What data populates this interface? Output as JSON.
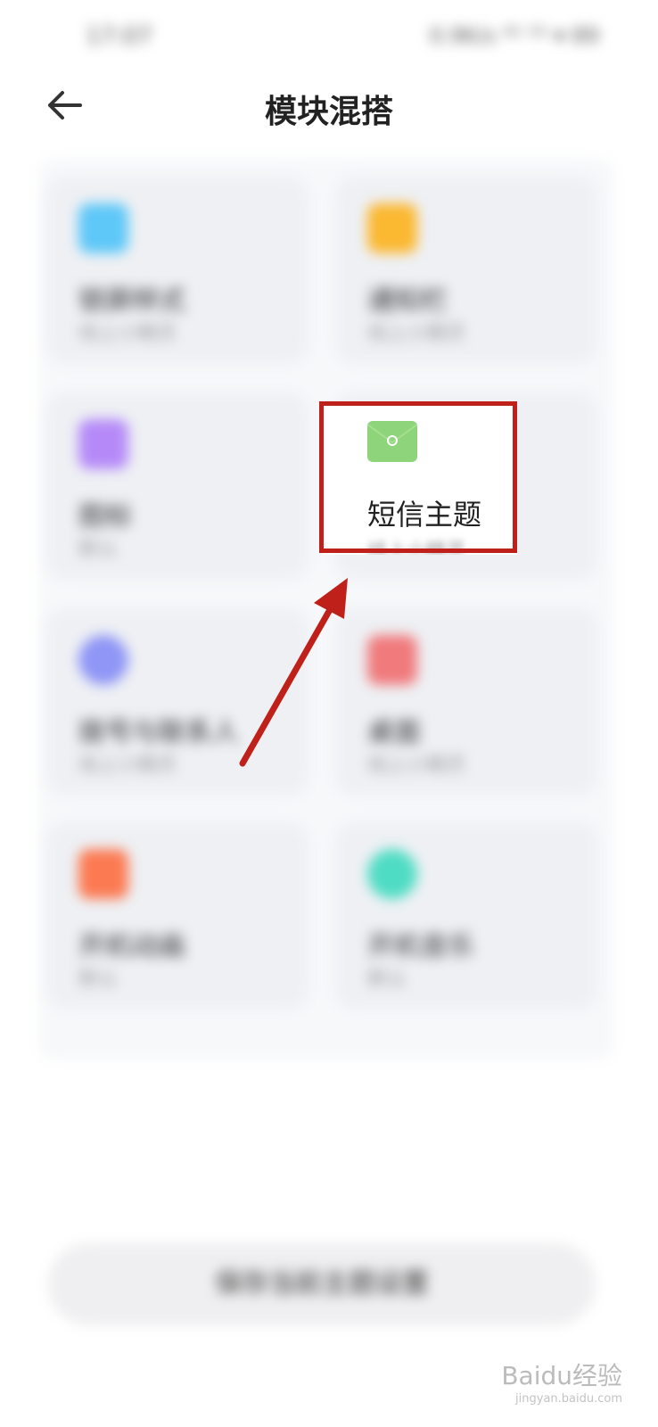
{
  "status_bar": {
    "time": "17:07",
    "icons": "0.9K/s ⁴ᴳ ⁵ᴳ ▾ 89"
  },
  "header": {
    "title": "模块混搭"
  },
  "cards": [
    {
      "title": "锁屏样式",
      "subtitle": "线上小精灵",
      "icon": "lock-screen-icon",
      "color": "#5ec8f8"
    },
    {
      "title": "通知栏",
      "subtitle": "线上小精灵",
      "icon": "notification-icon",
      "color": "#fbb831"
    },
    {
      "title": "图标",
      "subtitle": "默认",
      "icon": "app-icons-icon",
      "color": "#b58af8"
    },
    {
      "title": "短信主题",
      "subtitle": "线上小精灵",
      "icon": "sms-envelope-icon",
      "color": "#8ed47a"
    },
    {
      "title": "拨号与联系人",
      "subtitle": "线上小精灵",
      "icon": "contacts-icon",
      "color": "#8f96f6"
    },
    {
      "title": "桌面",
      "subtitle": "线上小精灵",
      "icon": "desktop-icon",
      "color": "#f07a7c"
    },
    {
      "title": "开机动画",
      "subtitle": "默认",
      "icon": "boot-animation-icon",
      "color": "#fb7a52"
    },
    {
      "title": "开机音乐",
      "subtitle": "默认",
      "icon": "boot-music-icon",
      "color": "#4fdcc4"
    }
  ],
  "bottom_button": {
    "label": "保存当前主题设置"
  },
  "watermark": {
    "brand": "Baidu经验",
    "url": "jingyan.baidu.com"
  },
  "annotation": {
    "color": "#c0201a"
  }
}
